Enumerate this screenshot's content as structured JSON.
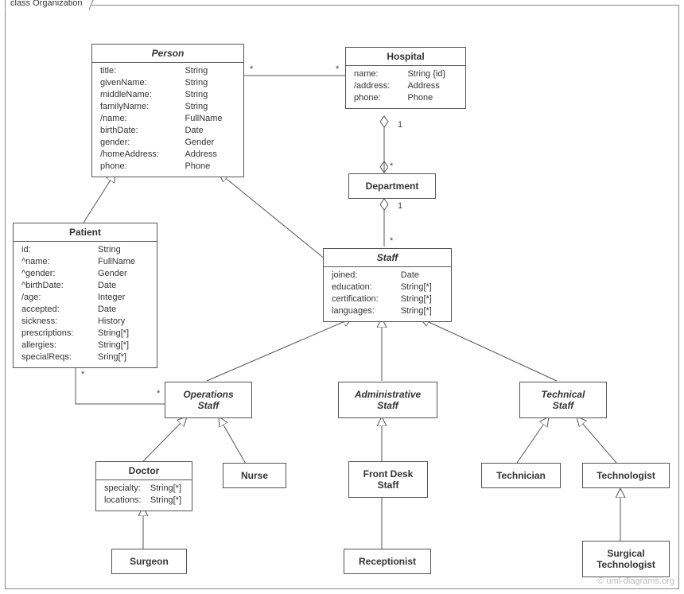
{
  "frame": {
    "label": "class Organization"
  },
  "watermark": "© uml-diagrams.org",
  "person": {
    "name": "Person",
    "attrs": [
      [
        "title:",
        "String"
      ],
      [
        "givenName:",
        "String"
      ],
      [
        "middleName:",
        "String"
      ],
      [
        "familyName:",
        "String"
      ],
      [
        "/name:",
        "FullName"
      ],
      [
        "birthDate:",
        "Date"
      ],
      [
        "gender:",
        "Gender"
      ],
      [
        "/homeAddress:",
        "Address"
      ],
      [
        "phone:",
        "Phone"
      ]
    ]
  },
  "hospital": {
    "name": "Hospital",
    "attrs": [
      [
        "name:",
        "String {id}"
      ],
      [
        "/address:",
        "Address"
      ],
      [
        "phone:",
        "Phone"
      ]
    ]
  },
  "department": {
    "name": "Department"
  },
  "patient": {
    "name": "Patient",
    "attrs": [
      [
        "id:",
        "String"
      ],
      [
        "^name:",
        "FullName"
      ],
      [
        "^gender:",
        "Gender"
      ],
      [
        "^birthDate:",
        "Date"
      ],
      [
        "/age:",
        "Integer"
      ],
      [
        "accepted:",
        "Date"
      ],
      [
        "sickness:",
        "History"
      ],
      [
        "prescriptions:",
        "String[*]"
      ],
      [
        "allergies:",
        "String[*]"
      ],
      [
        "specialReqs:",
        "Sring[*]"
      ]
    ]
  },
  "staff": {
    "name": "Staff",
    "attrs": [
      [
        "joined:",
        "Date"
      ],
      [
        "education:",
        "String[*]"
      ],
      [
        "certification:",
        "String[*]"
      ],
      [
        "languages:",
        "String[*]"
      ]
    ]
  },
  "opsstaff": {
    "name": "Operations",
    "name2": "Staff"
  },
  "adminstaff": {
    "name": "Administrative",
    "name2": "Staff"
  },
  "techstaff": {
    "name": "Technical",
    "name2": "Staff"
  },
  "doctor": {
    "name": "Doctor",
    "attrs": [
      [
        "specialty:",
        "String[*]"
      ],
      [
        "locations:",
        "String[*]"
      ]
    ]
  },
  "nurse": {
    "name": "Nurse"
  },
  "frontdesk": {
    "name": "Front Desk",
    "name2": "Staff"
  },
  "technician": {
    "name": "Technician"
  },
  "technologist": {
    "name": "Technologist"
  },
  "surgeon": {
    "name": "Surgeon"
  },
  "receptionist": {
    "name": "Receptionist"
  },
  "surgtech": {
    "name": "Surgical",
    "name2": "Technologist"
  },
  "mult": {
    "star": "*",
    "one": "1"
  }
}
